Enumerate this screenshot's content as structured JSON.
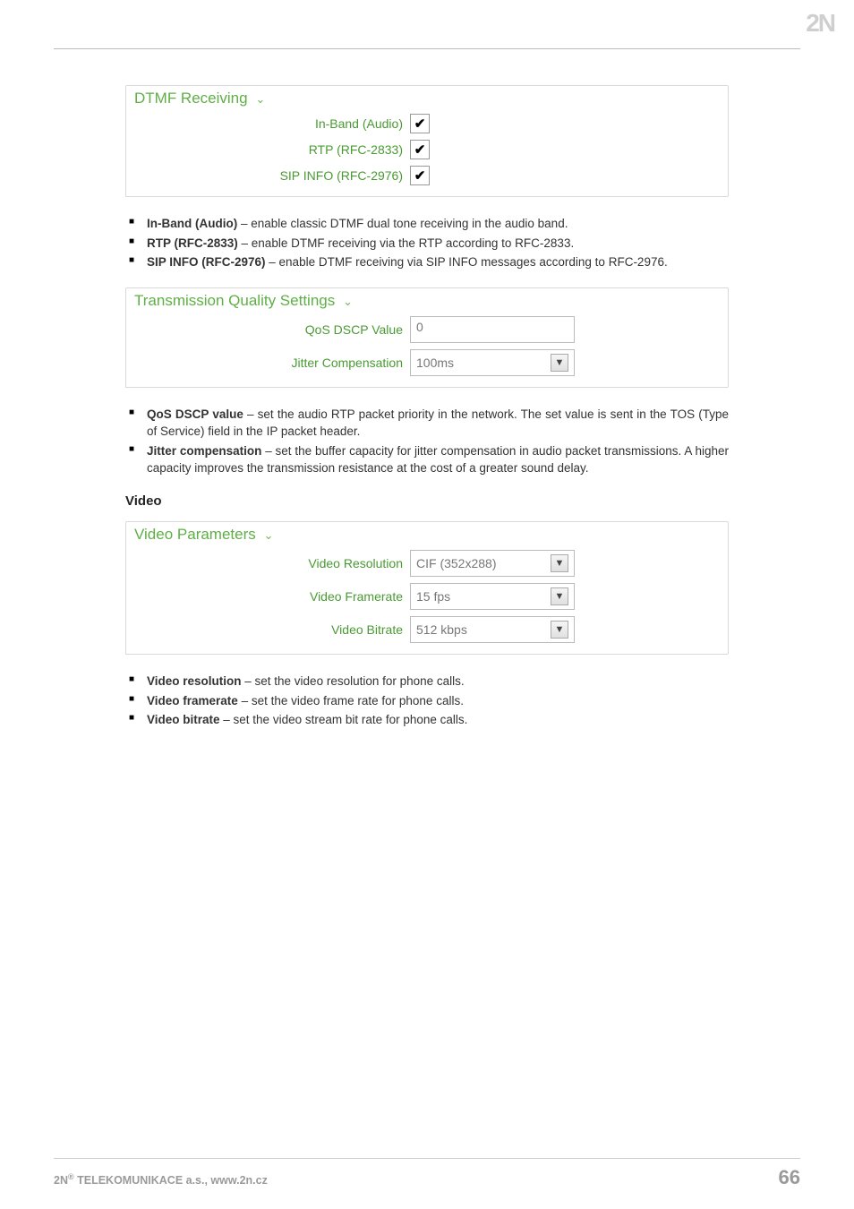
{
  "logo_text": "2N",
  "dtmf": {
    "legend": "DTMF Receiving",
    "rows": [
      {
        "label": "In-Band (Audio)",
        "checked": true
      },
      {
        "label": "RTP (RFC-2833)",
        "checked": true
      },
      {
        "label": "SIP INFO (RFC-2976)",
        "checked": true
      }
    ]
  },
  "dtmf_notes": [
    {
      "term": "In-Band (Audio)",
      "desc": " – enable classic DTMF dual tone receiving in the audio band."
    },
    {
      "term": "RTP (RFC-2833)",
      "desc": " – enable DTMF receiving via the RTP according to RFC-2833."
    },
    {
      "term": "SIP INFO (RFC-2976)",
      "desc": " – enable DTMF receiving via SIP INFO messages according to RFC-2976."
    }
  ],
  "tq": {
    "legend": "Transmission Quality Settings",
    "rows": [
      {
        "label": "QoS DSCP Value",
        "type": "text",
        "value": "0"
      },
      {
        "label": "Jitter Compensation",
        "type": "select",
        "value": "100ms"
      }
    ]
  },
  "tq_notes": [
    {
      "term": "QoS DSCP value",
      "desc": " – set the audio RTP packet priority in the network. The set value is sent in the TOS (Type of Service) field in the IP packet header."
    },
    {
      "term": "Jitter compensation",
      "desc": " – set the buffer capacity for jitter compensation in audio packet transmissions. A higher capacity improves the transmission resistance at the cost of a greater sound delay."
    }
  ],
  "video_heading": "Video",
  "vp": {
    "legend": "Video Parameters",
    "rows": [
      {
        "label": "Video Resolution",
        "type": "select",
        "value": "CIF (352x288)"
      },
      {
        "label": "Video Framerate",
        "type": "select",
        "value": "15 fps"
      },
      {
        "label": "Video Bitrate",
        "type": "select",
        "value": "512 kbps"
      }
    ]
  },
  "vp_notes": [
    {
      "term": "Video resolution",
      "desc": " – set the video resolution for phone calls."
    },
    {
      "term": "Video framerate",
      "desc": " – set the video frame rate for phone calls."
    },
    {
      "term": "Video bitrate",
      "desc": " – set the video stream bit rate for phone calls."
    }
  ],
  "footer": {
    "left_prefix": "2N",
    "left_sup": "®",
    "left_rest": " TELEKOMUNIKACE a.s., www.2n.cz",
    "page": "66"
  }
}
